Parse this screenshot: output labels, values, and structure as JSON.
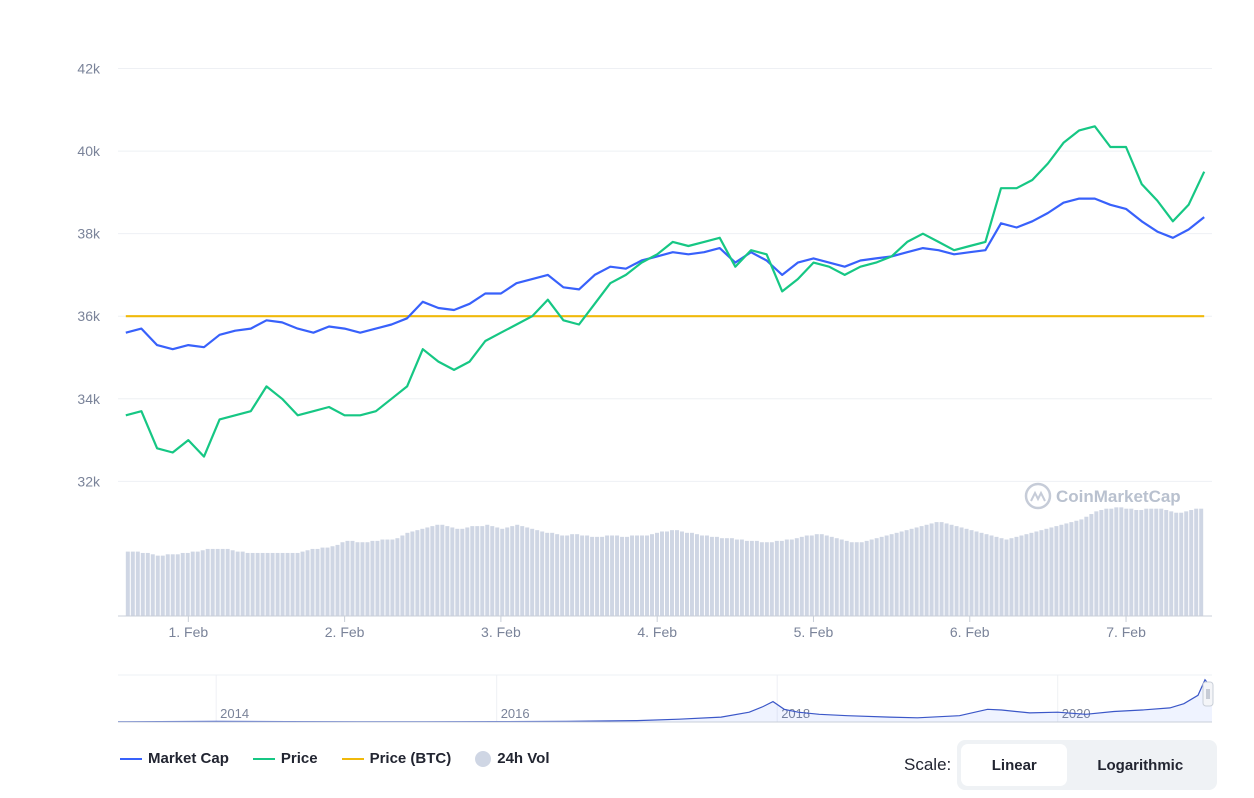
{
  "chart_data": {
    "type": "line",
    "y_axis": {
      "ticks": [
        "42k",
        "40k",
        "38k",
        "36k",
        "34k",
        "32k"
      ],
      "tick_values": [
        42000,
        40000,
        38000,
        36000,
        34000,
        32000
      ],
      "ylim": [
        31500,
        42400
      ]
    },
    "x_axis": {
      "ticks": [
        "1. Feb",
        "2. Feb",
        "3. Feb",
        "4. Feb",
        "5. Feb",
        "6. Feb",
        "7. Feb"
      ],
      "tick_values": [
        1,
        2,
        3,
        4,
        5,
        6,
        7
      ],
      "xlim": [
        0.55,
        7.55
      ]
    },
    "grid": true,
    "series": [
      {
        "name": "Market Cap",
        "color": "#3861fb",
        "x": [
          0.6,
          0.7,
          0.8,
          0.9,
          1.0,
          1.1,
          1.2,
          1.3,
          1.4,
          1.5,
          1.6,
          1.7,
          1.8,
          1.9,
          2.0,
          2.1,
          2.2,
          2.3,
          2.4,
          2.5,
          2.6,
          2.7,
          2.8,
          2.9,
          3.0,
          3.1,
          3.2,
          3.3,
          3.4,
          3.5,
          3.6,
          3.7,
          3.8,
          3.9,
          4.0,
          4.1,
          4.2,
          4.3,
          4.4,
          4.5,
          4.6,
          4.7,
          4.8,
          4.9,
          5.0,
          5.1,
          5.2,
          5.3,
          5.4,
          5.5,
          5.6,
          5.7,
          5.8,
          5.9,
          6.0,
          6.1,
          6.2,
          6.3,
          6.4,
          6.5,
          6.6,
          6.7,
          6.8,
          6.9,
          7.0,
          7.1,
          7.2,
          7.3,
          7.4,
          7.5
        ],
        "y": [
          35600,
          35700,
          35300,
          35200,
          35300,
          35250,
          35550,
          35650,
          35700,
          35900,
          35850,
          35700,
          35600,
          35750,
          35700,
          35600,
          35700,
          35800,
          35950,
          36350,
          36200,
          36150,
          36300,
          36550,
          36550,
          36800,
          36900,
          37000,
          36700,
          36650,
          37000,
          37200,
          37150,
          37350,
          37450,
          37550,
          37500,
          37550,
          37650,
          37300,
          37550,
          37350,
          37000,
          37300,
          37400,
          37300,
          37200,
          37350,
          37400,
          37450,
          37550,
          37650,
          37600,
          37500,
          37550,
          37600,
          38250,
          38150,
          38300,
          38500,
          38750,
          38850,
          38850,
          38700,
          38600,
          38300,
          38050,
          37900,
          38100,
          38400
        ]
      },
      {
        "name": "Price",
        "color": "#16c784",
        "x": [
          0.6,
          0.7,
          0.8,
          0.9,
          1.0,
          1.1,
          1.2,
          1.3,
          1.4,
          1.5,
          1.6,
          1.7,
          1.8,
          1.9,
          2.0,
          2.1,
          2.2,
          2.3,
          2.4,
          2.5,
          2.6,
          2.7,
          2.8,
          2.9,
          3.0,
          3.1,
          3.2,
          3.3,
          3.4,
          3.5,
          3.6,
          3.7,
          3.8,
          3.9,
          4.0,
          4.1,
          4.2,
          4.3,
          4.4,
          4.5,
          4.6,
          4.7,
          4.8,
          4.9,
          5.0,
          5.1,
          5.2,
          5.3,
          5.4,
          5.5,
          5.6,
          5.7,
          5.8,
          5.9,
          6.0,
          6.1,
          6.2,
          6.3,
          6.4,
          6.5,
          6.6,
          6.7,
          6.8,
          6.9,
          7.0,
          7.1,
          7.2,
          7.3,
          7.4,
          7.5
        ],
        "y": [
          33600,
          33700,
          32800,
          32700,
          33000,
          32600,
          33500,
          33600,
          33700,
          34300,
          34000,
          33600,
          33700,
          33800,
          33600,
          33600,
          33700,
          34000,
          34300,
          35200,
          34900,
          34700,
          34900,
          35400,
          35600,
          35800,
          36000,
          36400,
          35900,
          35800,
          36300,
          36800,
          37000,
          37300,
          37500,
          37800,
          37700,
          37800,
          37900,
          37200,
          37600,
          37500,
          36600,
          36900,
          37300,
          37200,
          37000,
          37200,
          37300,
          37450,
          37800,
          38000,
          37800,
          37600,
          37700,
          37800,
          39100,
          39100,
          39300,
          39700,
          40200,
          40500,
          40600,
          40100,
          40100,
          39200,
          38800,
          38300,
          38700,
          39500
        ]
      },
      {
        "name": "Price (BTC)",
        "color": "#f0b90b",
        "x": [
          0.6,
          7.5
        ],
        "y": [
          36000,
          36000
        ]
      },
      {
        "name": "24h Vol",
        "color": "#cfd6e4",
        "type": "bar",
        "x_start": 0.6,
        "x_end": 7.5,
        "values": [
          0.48,
          0.48,
          0.48,
          0.47,
          0.47,
          0.46,
          0.45,
          0.45,
          0.46,
          0.46,
          0.46,
          0.47,
          0.47,
          0.48,
          0.48,
          0.49,
          0.5,
          0.5,
          0.5,
          0.5,
          0.5,
          0.49,
          0.48,
          0.48,
          0.47,
          0.47,
          0.47,
          0.47,
          0.47,
          0.47,
          0.47,
          0.47,
          0.47,
          0.47,
          0.47,
          0.48,
          0.49,
          0.5,
          0.5,
          0.51,
          0.51,
          0.52,
          0.53,
          0.55,
          0.56,
          0.56,
          0.55,
          0.55,
          0.55,
          0.56,
          0.56,
          0.57,
          0.57,
          0.57,
          0.58,
          0.6,
          0.62,
          0.63,
          0.64,
          0.65,
          0.66,
          0.67,
          0.68,
          0.68,
          0.67,
          0.66,
          0.65,
          0.65,
          0.66,
          0.67,
          0.67,
          0.67,
          0.68,
          0.67,
          0.66,
          0.65,
          0.66,
          0.67,
          0.68,
          0.67,
          0.66,
          0.65,
          0.64,
          0.63,
          0.62,
          0.62,
          0.61,
          0.6,
          0.6,
          0.61,
          0.61,
          0.6,
          0.6,
          0.59,
          0.59,
          0.59,
          0.6,
          0.6,
          0.6,
          0.59,
          0.59,
          0.6,
          0.6,
          0.6,
          0.6,
          0.61,
          0.62,
          0.63,
          0.63,
          0.64,
          0.64,
          0.63,
          0.62,
          0.62,
          0.61,
          0.6,
          0.6,
          0.59,
          0.59,
          0.58,
          0.58,
          0.58,
          0.57,
          0.57,
          0.56,
          0.56,
          0.56,
          0.55,
          0.55,
          0.55,
          0.56,
          0.56,
          0.57,
          0.57,
          0.58,
          0.59,
          0.6,
          0.6,
          0.61,
          0.61,
          0.6,
          0.59,
          0.58,
          0.57,
          0.56,
          0.55,
          0.55,
          0.55,
          0.56,
          0.57,
          0.58,
          0.59,
          0.6,
          0.61,
          0.62,
          0.63,
          0.64,
          0.65,
          0.66,
          0.67,
          0.68,
          0.69,
          0.7,
          0.7,
          0.69,
          0.68,
          0.67,
          0.66,
          0.65,
          0.64,
          0.63,
          0.62,
          0.61,
          0.6,
          0.59,
          0.58,
          0.57,
          0.58,
          0.59,
          0.6,
          0.61,
          0.62,
          0.63,
          0.64,
          0.65,
          0.66,
          0.67,
          0.68,
          0.69,
          0.7,
          0.71,
          0.72,
          0.74,
          0.76,
          0.78,
          0.79,
          0.8,
          0.8,
          0.81,
          0.81,
          0.8,
          0.8,
          0.79,
          0.79,
          0.8,
          0.8,
          0.8,
          0.8,
          0.79,
          0.78,
          0.77,
          0.77,
          0.78,
          0.79,
          0.8,
          0.8
        ]
      }
    ],
    "navigator": {
      "ticks": [
        "2014",
        "2016",
        "2018",
        "2020"
      ],
      "tick_values": [
        2014,
        2016,
        2018,
        2020
      ],
      "xlim": [
        2013.3,
        2021.1
      ],
      "series": {
        "x": [
          2013.3,
          2013.6,
          2014.0,
          2014.5,
          2015.0,
          2015.5,
          2016.0,
          2016.5,
          2017.0,
          2017.3,
          2017.6,
          2017.8,
          2017.9,
          2017.97,
          2018.05,
          2018.15,
          2018.3,
          2018.5,
          2018.8,
          2019.0,
          2019.3,
          2019.5,
          2019.6,
          2019.8,
          2020.0,
          2020.2,
          2020.4,
          2020.6,
          2020.8,
          2020.9,
          2021.0,
          2021.05,
          2021.1
        ],
        "y": [
          0.02,
          0.03,
          0.04,
          0.03,
          0.02,
          0.02,
          0.03,
          0.05,
          0.1,
          0.2,
          0.35,
          0.7,
          1.1,
          1.45,
          0.9,
          0.7,
          0.55,
          0.45,
          0.35,
          0.3,
          0.45,
          0.9,
          0.85,
          0.65,
          0.7,
          0.55,
          0.75,
          0.85,
          1.0,
          1.3,
          1.9,
          3.0,
          2.4
        ]
      },
      "ylim": [
        0,
        3.2
      ]
    },
    "watermark": "CoinMarketCap"
  },
  "legend": [
    {
      "label": "Market Cap",
      "color": "#3861fb",
      "marker": "line"
    },
    {
      "label": "Price",
      "color": "#16c784",
      "marker": "line"
    },
    {
      "label": "Price (BTC)",
      "color": "#f0b90b",
      "marker": "line"
    },
    {
      "label": "24h Vol",
      "color": "#cfd6e4",
      "marker": "dot"
    }
  ],
  "scale": {
    "label": "Scale:",
    "options": [
      "Linear",
      "Logarithmic"
    ],
    "selected": "Linear"
  }
}
